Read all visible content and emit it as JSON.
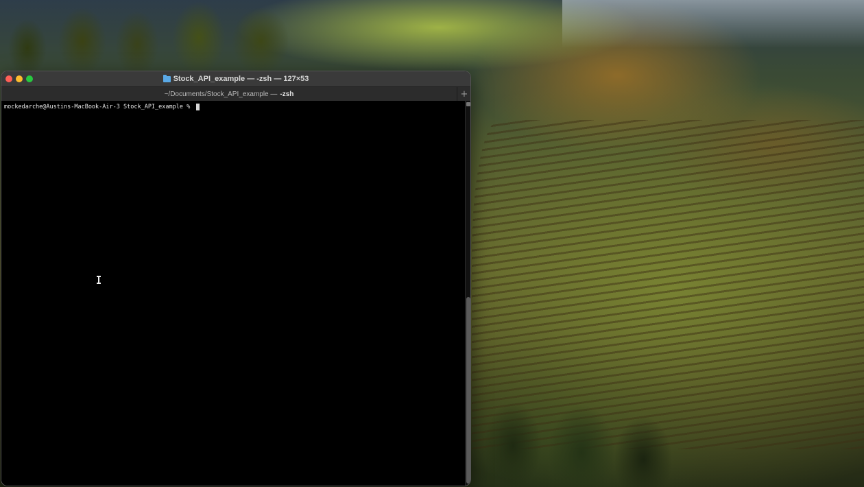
{
  "window": {
    "title": "Stock_API_example — -zsh — 127×53",
    "folder_icon": "folder-icon"
  },
  "tab": {
    "path": "~/Documents/Stock_API_example — ",
    "shell": "-zsh",
    "new_tab_label": "+"
  },
  "terminal": {
    "prompt": "mockedarche@Austins-MacBook-Air-3 Stock_API_example % ",
    "background": "#000000",
    "text_color": "#e8e8e8"
  },
  "colors": {
    "close": "#ff5f57",
    "minimize": "#febc2e",
    "zoom": "#28c840",
    "folder": "#5aa9e6"
  }
}
